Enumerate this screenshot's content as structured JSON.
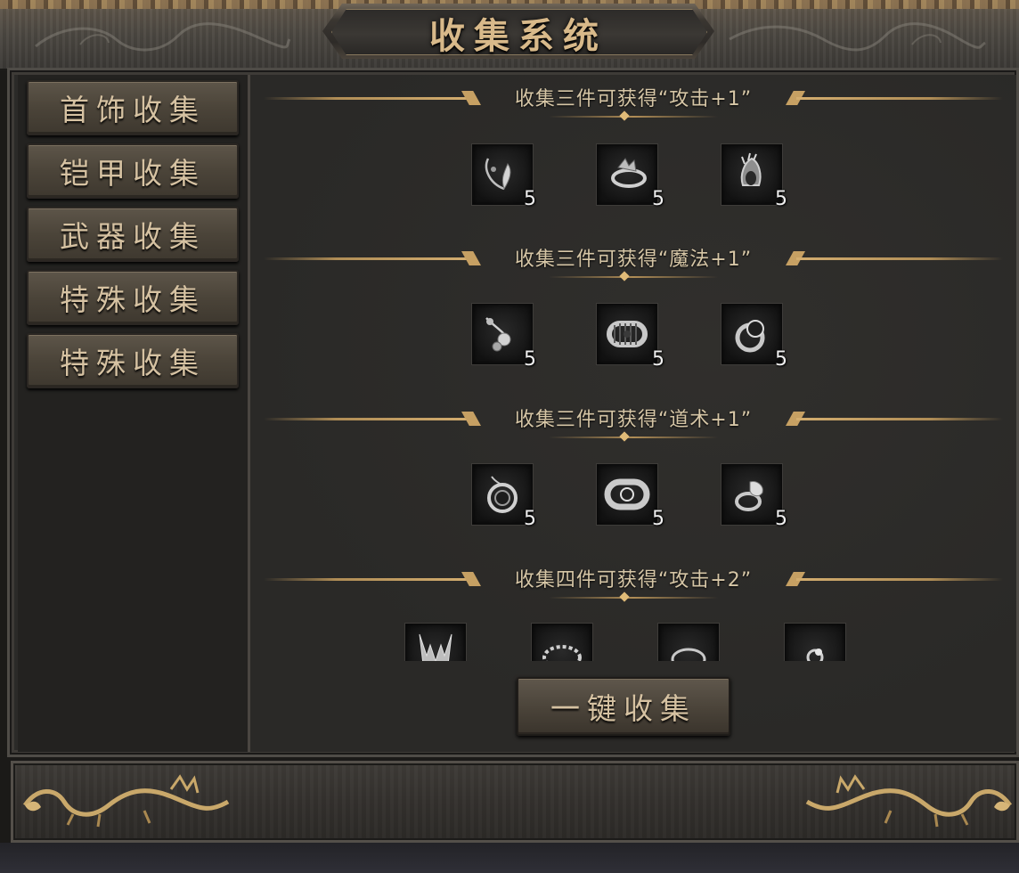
{
  "window": {
    "title": "收集系统"
  },
  "sidebar": {
    "tabs": [
      {
        "label": "首饰收集"
      },
      {
        "label": "铠甲收集"
      },
      {
        "label": "武器收集"
      },
      {
        "label": "特殊收集"
      },
      {
        "label": "特殊收集"
      }
    ]
  },
  "sections": [
    {
      "title": "收集三件可获得“攻击+1”",
      "items": [
        {
          "icon": "necklace-icon",
          "count": "5"
        },
        {
          "icon": "bracelet-icon",
          "count": "5"
        },
        {
          "icon": "ring-icon",
          "count": "5"
        }
      ]
    },
    {
      "title": "收集三件可获得“魔法+1”",
      "items": [
        {
          "icon": "necklace-icon",
          "count": "5"
        },
        {
          "icon": "bracelet-icon",
          "count": "5"
        },
        {
          "icon": "ring-icon",
          "count": "5"
        }
      ]
    },
    {
      "title": "收集三件可获得“道术+1”",
      "items": [
        {
          "icon": "amulet-icon",
          "count": "5"
        },
        {
          "icon": "bracelet-icon",
          "count": "5"
        },
        {
          "icon": "ring-icon",
          "count": "5"
        }
      ]
    },
    {
      "title": "收集四件可获得“攻击+2”",
      "items": [
        {
          "icon": "helmet-icon"
        },
        {
          "icon": "necklace-icon"
        },
        {
          "icon": "bracelet-icon"
        },
        {
          "icon": "ring-icon"
        }
      ]
    }
  ],
  "actions": {
    "collect_all_label": "一键收集"
  },
  "colors": {
    "gold_accent": "#c6a063",
    "tab_text": "#d6c2a2",
    "panel_bg": "#2a2927"
  }
}
